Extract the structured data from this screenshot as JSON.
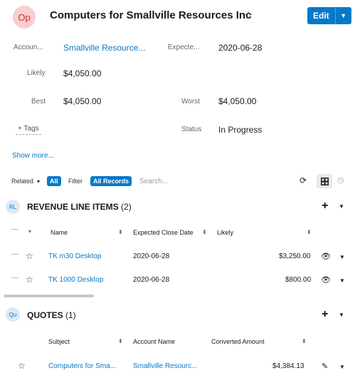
{
  "header": {
    "avatar_initials": "Op",
    "title": "Computers for Smallville Resources Inc",
    "edit_label": "Edit"
  },
  "fields": {
    "account": {
      "label": "Accoun...",
      "value": "Smallville Resource..."
    },
    "expected": {
      "label": "Expecte...",
      "value": "2020-06-28"
    },
    "likely": {
      "label": "Likely",
      "value": "$4,050.00"
    },
    "best": {
      "label": "Best",
      "value": "$4,050.00"
    },
    "worst": {
      "label": "Worst",
      "value": "$4,050.00"
    },
    "tags_label": "+ Tags",
    "status": {
      "label": "Status",
      "value": "In Progress"
    }
  },
  "show_more": "Show more...",
  "filter_bar": {
    "related_label": "Related",
    "related_value": "All",
    "filter_label": "Filter",
    "filter_value": "All Records",
    "search_placeholder": "Search..."
  },
  "revenue": {
    "badge": "RL",
    "title": "REVENUE LINE ITEMS",
    "count": "(2)",
    "columns": [
      "Name",
      "Expected Close Date",
      "Likely"
    ],
    "rows": [
      {
        "name": "TK m30 Desktop",
        "date": "2020-06-28",
        "amount": "$3,250.00"
      },
      {
        "name": "TK 1000 Desktop",
        "date": "2020-06-28",
        "amount": "$800.00"
      }
    ]
  },
  "quotes": {
    "badge": "Qu",
    "title": "QUOTES",
    "count": "(1)",
    "columns": [
      "Subject",
      "Account Name",
      "Converted Amount"
    ],
    "rows": [
      {
        "subject": "Computers for Sma...",
        "account": "Smallville Resourc...",
        "amount": "$4,384.13"
      }
    ]
  },
  "colors": {
    "accent": "#0679c8",
    "avatar_bg": "#f7cfd0",
    "avatar_fg": "#d0322f"
  }
}
